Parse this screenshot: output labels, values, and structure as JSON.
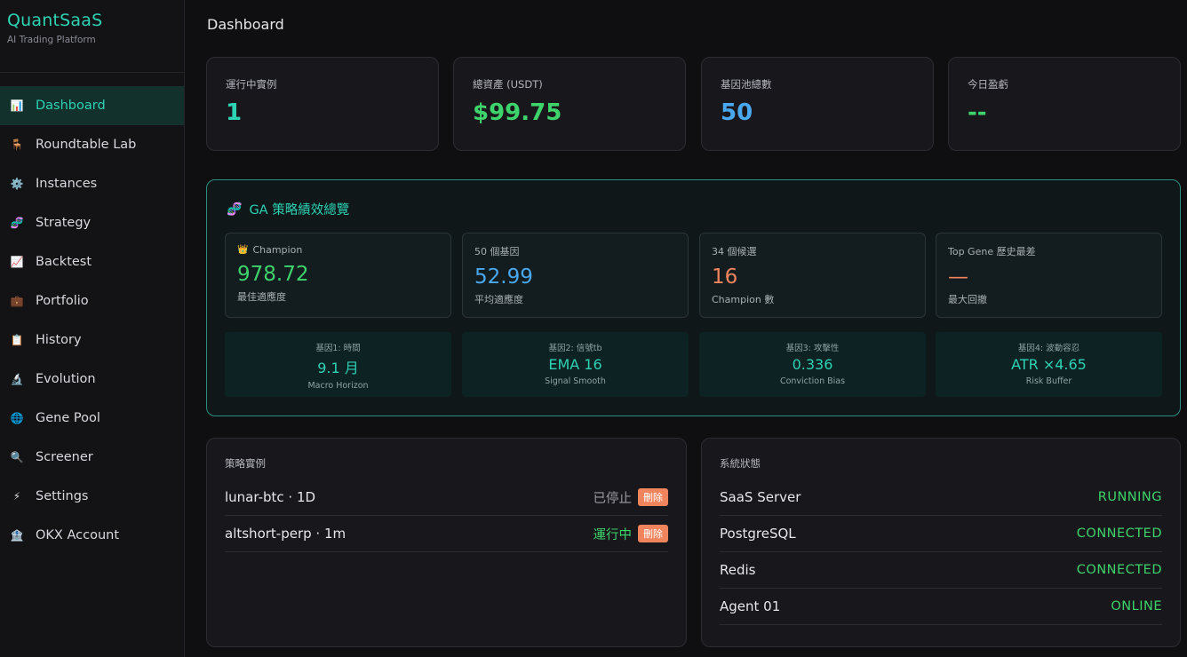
{
  "brand": {
    "title": "QuantSaaS",
    "subtitle": "AI Trading Platform"
  },
  "nav": [
    {
      "label": "Dashboard",
      "icon": "📊"
    },
    {
      "label": "Roundtable Lab",
      "icon": "🪑"
    },
    {
      "label": "Instances",
      "icon": "⚙️"
    },
    {
      "label": "Strategy",
      "icon": "🧬"
    },
    {
      "label": "Backtest",
      "icon": "📈"
    },
    {
      "label": "Portfolio",
      "icon": "💼"
    },
    {
      "label": "History",
      "icon": "📋"
    },
    {
      "label": "Evolution",
      "icon": "🔬"
    },
    {
      "label": "Gene Pool",
      "icon": "🌐"
    },
    {
      "label": "Screener",
      "icon": "🔍"
    },
    {
      "label": "Settings",
      "icon": "⚡"
    },
    {
      "label": "OKX Account",
      "icon": "🏦"
    }
  ],
  "page_title": "Dashboard",
  "stats": [
    {
      "label": "運行中實例",
      "value": "1",
      "color": "#2ed3b4"
    },
    {
      "label": "總資產 (USDT)",
      "value": "$99.75",
      "color": "#3ed36b"
    },
    {
      "label": "基因池總數",
      "value": "50",
      "color": "#4aa8ee"
    },
    {
      "label": "今日盈虧",
      "value": "--",
      "color": "#3ed36b"
    }
  ],
  "ga": {
    "icon": "🧬",
    "title": "GA 策略績效總覽",
    "cards": [
      {
        "icon": "👑",
        "label": "Champion",
        "value": "978.72",
        "sub": "最佳適應度",
        "color": "#3ed36b"
      },
      {
        "icon": "",
        "label": "50 個基因",
        "value": "52.99",
        "sub": "平均適應度",
        "color": "#4aa8ee"
      },
      {
        "icon": "",
        "label": "34 個候選",
        "value": "16",
        "sub": "Champion 數",
        "color": "#f0845c"
      },
      {
        "icon": "",
        "label": "Top Gene 歷史最差",
        "value": "—",
        "sub": "最大回撤",
        "color": "#f0845c"
      }
    ],
    "genes": [
      {
        "label": "基因1: 時間",
        "value": "9.1 月",
        "sub": "Macro Horizon"
      },
      {
        "label": "基因2: 信號tb",
        "value": "EMA 16",
        "sub": "Signal Smooth"
      },
      {
        "label": "基因3: 攻擊性",
        "value": "0.336",
        "sub": "Conviction Bias"
      },
      {
        "label": "基因4: 波動容忍",
        "value": "ATR ×4.65",
        "sub": "Risk Buffer"
      }
    ]
  },
  "instances": {
    "title": "策略實例",
    "rows": [
      {
        "name": "lunar-btc · 1D",
        "status": "已停止",
        "status_color": "#9a9aa2",
        "action": "刪除"
      },
      {
        "name": "altshort-perp · 1m",
        "status": "運行中",
        "status_color": "#3ed36b",
        "action": "刪除"
      }
    ]
  },
  "system": {
    "title": "系統狀態",
    "rows": [
      {
        "name": "SaaS Server",
        "status": "RUNNING"
      },
      {
        "name": "PostgreSQL",
        "status": "CONNECTED"
      },
      {
        "name": "Redis",
        "status": "CONNECTED"
      },
      {
        "name": "Agent 01",
        "status": "ONLINE"
      }
    ]
  }
}
